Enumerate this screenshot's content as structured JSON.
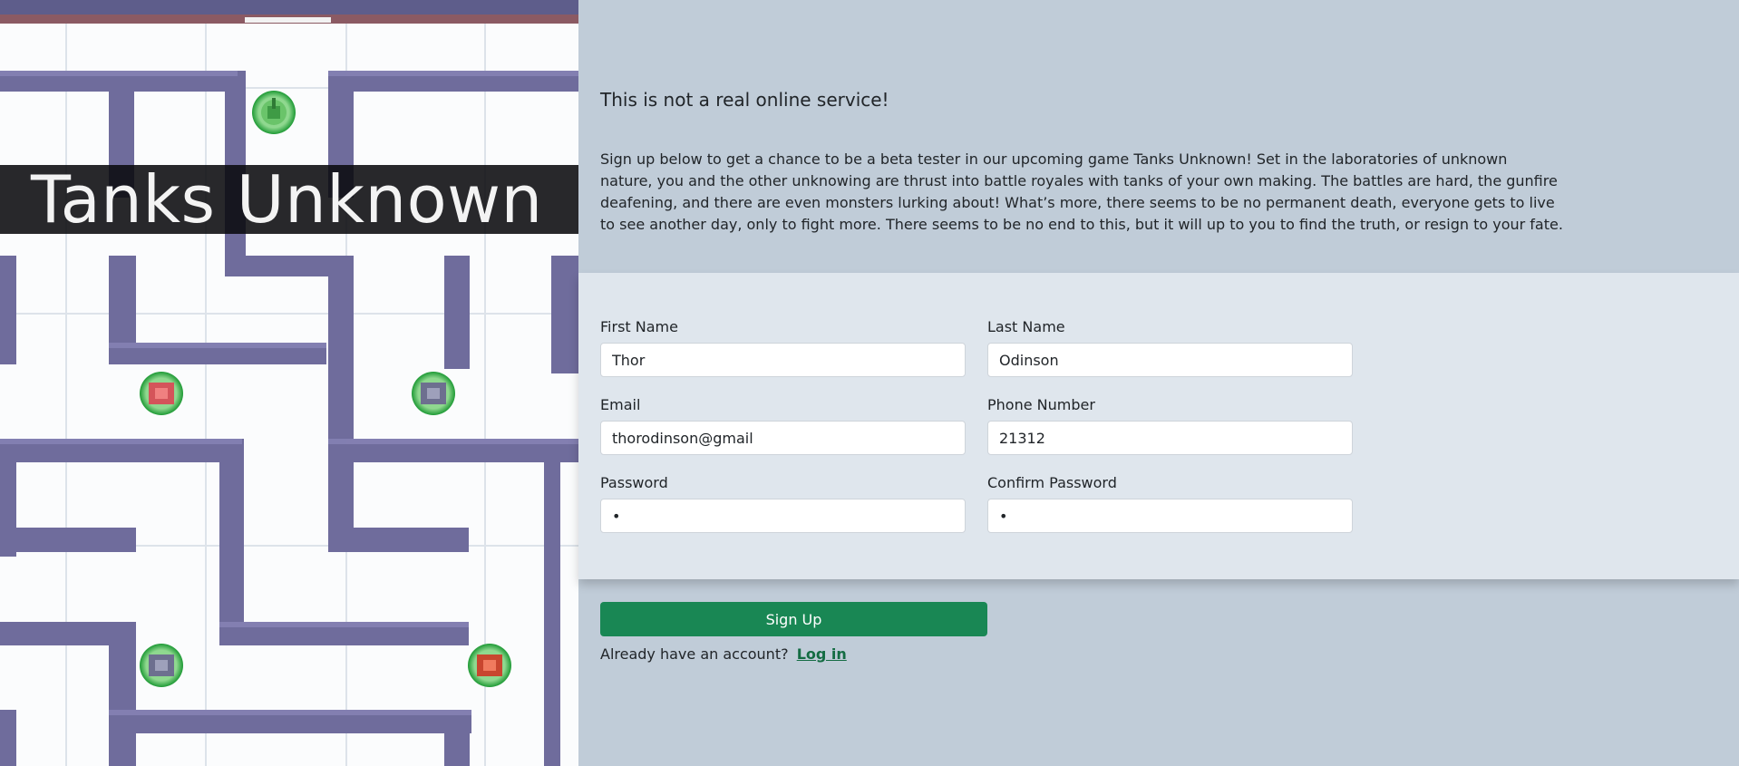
{
  "hero": {
    "game_title": "Tanks Unknown"
  },
  "intro": {
    "heading": "This is not a real online service!",
    "description": "Sign up below to get a chance to be a beta tester in our upcoming game Tanks Unknown! Set in the laboratories of unknown nature, you and the other unknowing are thrust into battle royales with tanks of your own making. The battles are hard, the gunfire deafening, and there are even monsters lurking about! What’s more, there seems to be no permanent death, everyone gets to live to see another day, only to fight more. There seems to be no end to this, but it will up to you to find the truth, or resign to your fate."
  },
  "form": {
    "first_name": {
      "label": "First Name",
      "value": "Thor"
    },
    "last_name": {
      "label": "Last Name",
      "value": "Odinson"
    },
    "email": {
      "label": "Email",
      "value": "thorodinson@gmail"
    },
    "phone": {
      "label": "Phone Number",
      "value": "21312"
    },
    "password": {
      "label": "Password",
      "value": "1"
    },
    "confirm_password": {
      "label": "Confirm Password",
      "value": "1"
    }
  },
  "actions": {
    "signup_label": "Sign Up",
    "login_prompt": "Already have an account?",
    "login_link": "Log in"
  },
  "colors": {
    "page_background": "#c0ccd8",
    "form_panel": "#dfe6ed",
    "primary_button": "#198754",
    "link": "#146c43",
    "maze_wall": "#6f6c9c",
    "tank_ring": "#2fae3f"
  },
  "icons": {
    "tanks": [
      "green-tank-icon",
      "red-tank-icon",
      "gray-tank-icon",
      "gray-tank-icon",
      "red-tank-icon"
    ]
  }
}
